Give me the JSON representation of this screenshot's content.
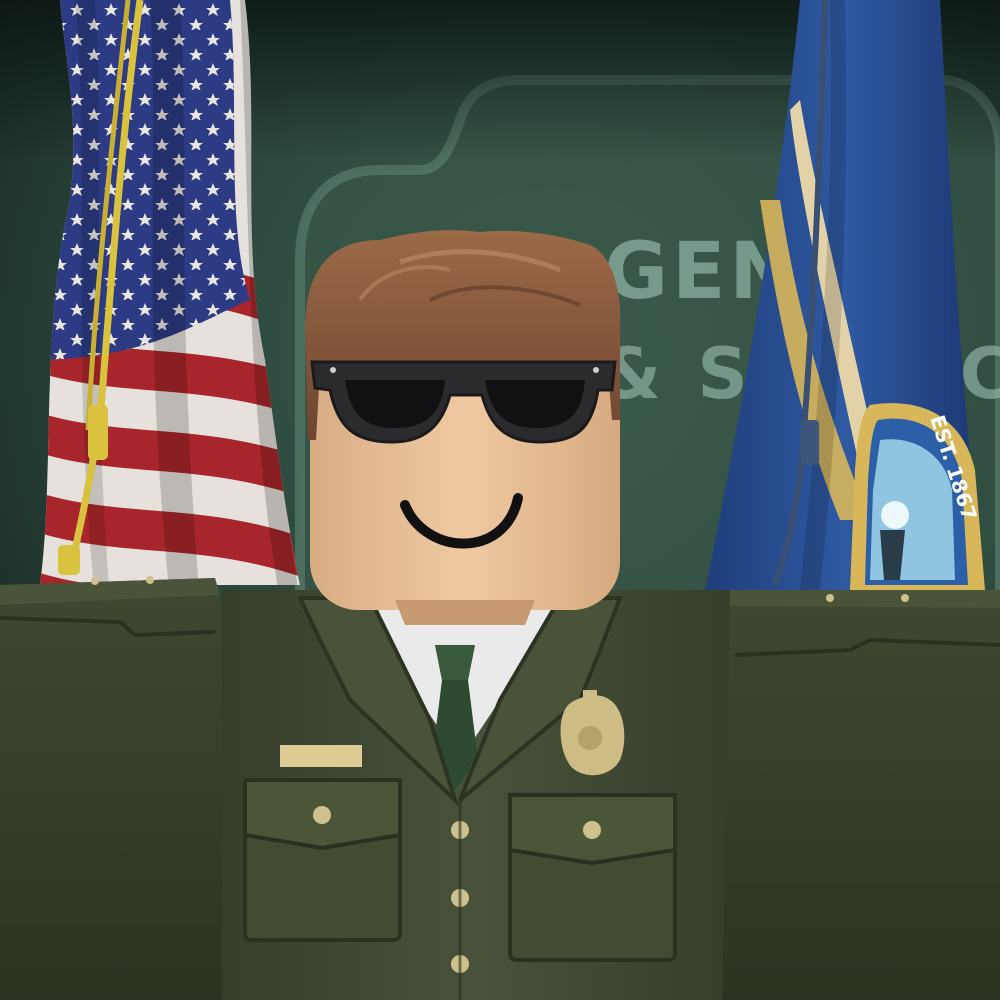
{
  "scene": {
    "wall_emblem": {
      "line1": "RGENCY",
      "line2": "& SERVIC"
    },
    "state_flag": {
      "seal_text": "EST. 1867"
    }
  },
  "colors": {
    "wall": "#2b473a",
    "uniform": "#434c32",
    "uniform_dark": "#363d28",
    "skin": "#ebc49c",
    "hair": "#8a5a3c",
    "us_flag_blue": "#2d3d86",
    "us_flag_red": "#a5252a",
    "state_flag_blue": "#2a4f93",
    "gold": "#d9c28a",
    "badge": "#cdbd85"
  },
  "icons": {
    "badge": "police-badge-icon",
    "nameplate": "nameplate-icon"
  }
}
